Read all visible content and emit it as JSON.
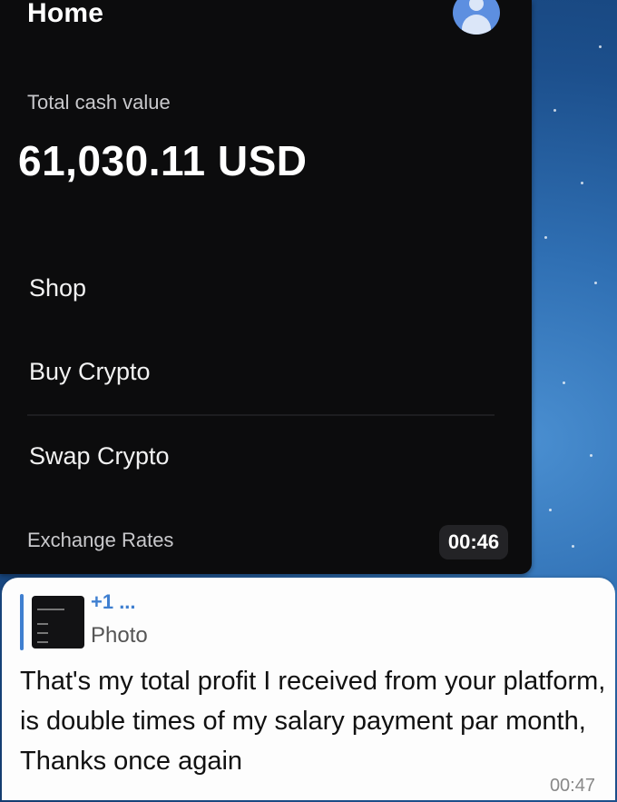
{
  "app": {
    "title": "Home",
    "total_cash_label": "Total cash value",
    "total_cash_value": "61,030.11 USD",
    "menu": [
      {
        "label": "Shop"
      },
      {
        "label": "Buy Crypto"
      },
      {
        "label": "Swap Crypto"
      }
    ],
    "exchange_rates_label": "Exchange Rates"
  },
  "video": {
    "timestamp": "00:46"
  },
  "message": {
    "reply_sender": "+1 ...",
    "reply_type": "Photo",
    "text": "That's my total profit I received from your platform, is double times of my salary payment par month, Thanks once again",
    "time": "00:47"
  },
  "colors": {
    "app_background": "#0c0c0d",
    "accent_blue": "#3f7fd0",
    "bubble_background": "#fdfdfd"
  }
}
